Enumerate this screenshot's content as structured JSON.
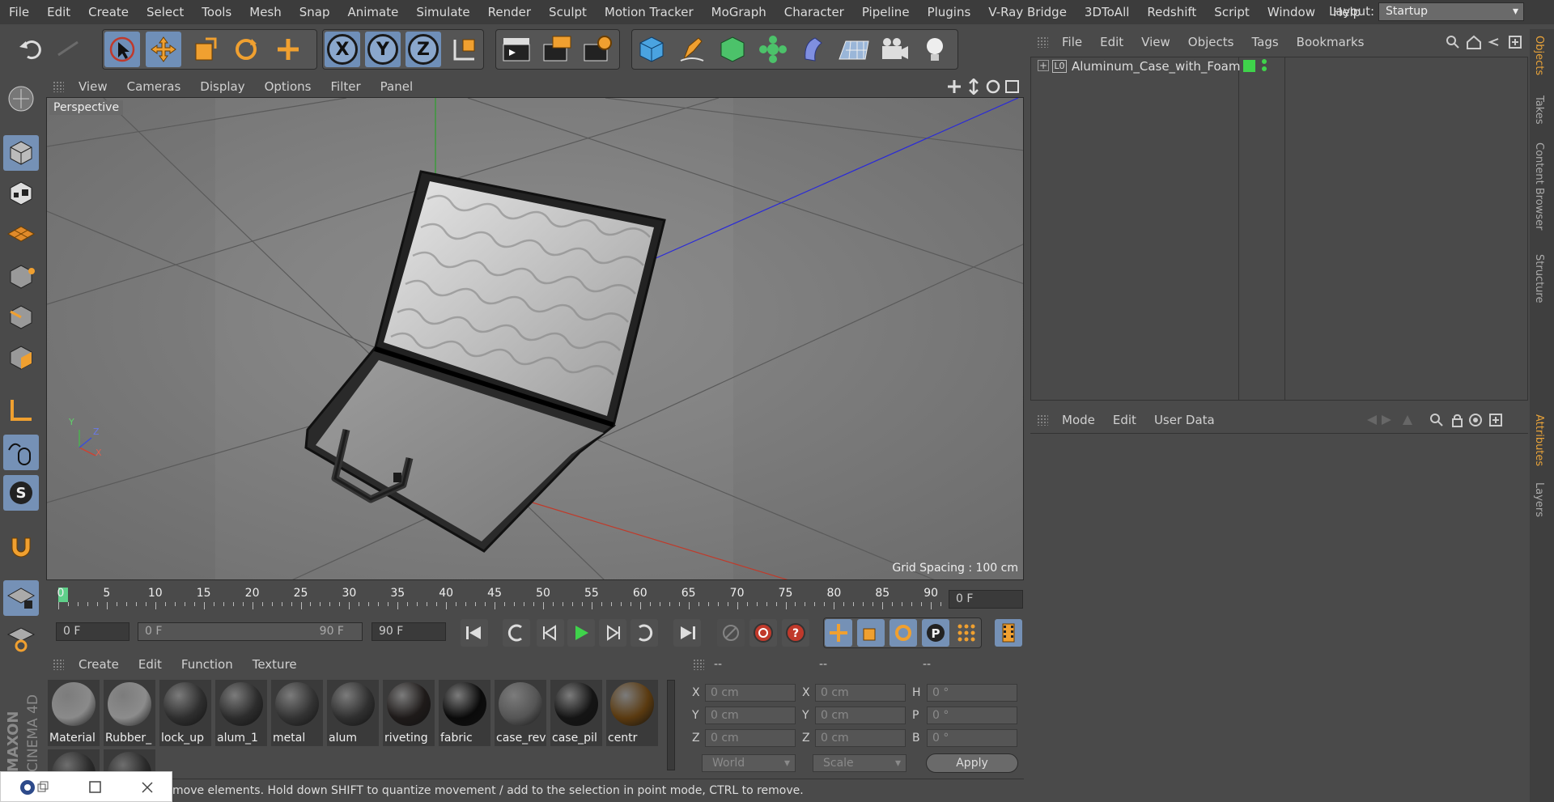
{
  "menubar": {
    "items": [
      "File",
      "Edit",
      "Create",
      "Select",
      "Tools",
      "Mesh",
      "Snap",
      "Animate",
      "Simulate",
      "Render",
      "Sculpt",
      "Motion Tracker",
      "MoGraph",
      "Character",
      "Pipeline",
      "Plugins",
      "V-Ray Bridge",
      "3DToAll",
      "Redshift",
      "Script",
      "Window",
      "Help"
    ],
    "layout_label": "Layout:",
    "layout_value": "Startup"
  },
  "toolbar": {
    "axis_x": "X",
    "axis_y": "Y",
    "axis_z": "Z"
  },
  "viewport": {
    "menu": [
      "View",
      "Cameras",
      "Display",
      "Options",
      "Filter",
      "Panel"
    ],
    "label": "Perspective",
    "grid_spacing": "Grid Spacing : 100 cm",
    "axis_y": "Y",
    "axis_z": "Z",
    "axis_x": "X"
  },
  "timeline": {
    "ticks": [
      "0",
      "5",
      "10",
      "15",
      "20",
      "25",
      "30",
      "35",
      "40",
      "45",
      "50",
      "55",
      "60",
      "65",
      "70",
      "75",
      "80",
      "85",
      "90"
    ],
    "current_frame": "0 F",
    "start_field": "0 F",
    "range_start": "0 F",
    "range_end": "90 F",
    "end_field": "90 F"
  },
  "materials": {
    "menu": [
      "Create",
      "Edit",
      "Function",
      "Texture"
    ],
    "items": [
      {
        "name": "Material",
        "color": "#8a8a8a"
      },
      {
        "name": "Rubber_",
        "color": "#8c8c8c"
      },
      {
        "name": "lock_up",
        "color": "#2e2e2e"
      },
      {
        "name": "alum_1",
        "color": "#2c2c2c"
      },
      {
        "name": "metal",
        "color": "#333333"
      },
      {
        "name": "alum",
        "color": "#2f2f2f"
      },
      {
        "name": "riveting",
        "color": "#1e1a19"
      },
      {
        "name": "fabric",
        "color": "#0a0a0a"
      },
      {
        "name": "case_rev",
        "color": "#555555"
      },
      {
        "name": "case_pil",
        "color": "#141414"
      },
      {
        "name": "centr",
        "color": "#5a3a10"
      }
    ]
  },
  "coordinates": {
    "header": [
      "--",
      "--",
      "--"
    ],
    "rows": [
      {
        "l1": "X",
        "v1": "0 cm",
        "l2": "X",
        "v2": "0 cm",
        "l3": "H",
        "v3": "0 °"
      },
      {
        "l1": "Y",
        "v1": "0 cm",
        "l2": "Y",
        "v2": "0 cm",
        "l3": "P",
        "v3": "0 °"
      },
      {
        "l1": "Z",
        "v1": "0 cm",
        "l2": "Z",
        "v2": "0 cm",
        "l3": "B",
        "v3": "0 °"
      }
    ],
    "space": "World",
    "mode": "Scale",
    "apply": "Apply"
  },
  "objects": {
    "menu": [
      "File",
      "Edit",
      "View",
      "Objects",
      "Tags",
      "Bookmarks"
    ],
    "tree": [
      {
        "name": "Aluminum_Case_with_Foam",
        "layer": "L0"
      }
    ]
  },
  "attributes": {
    "menu": [
      "Mode",
      "Edit",
      "User Data"
    ]
  },
  "side_tabs": [
    "Objects",
    "Takes",
    "Content Browser",
    "Structure",
    "Attributes",
    "Layers"
  ],
  "status": {
    "text": "move elements. Hold down SHIFT to quantize movement / add to the selection in point mode, CTRL to remove."
  },
  "brand": {
    "line1": "MAXON",
    "line2": "CINEMA 4D"
  },
  "colors": {
    "accent_blue": "#7591b6",
    "accent_orange": "#e8a33a",
    "green_tag": "#3fd34b"
  }
}
